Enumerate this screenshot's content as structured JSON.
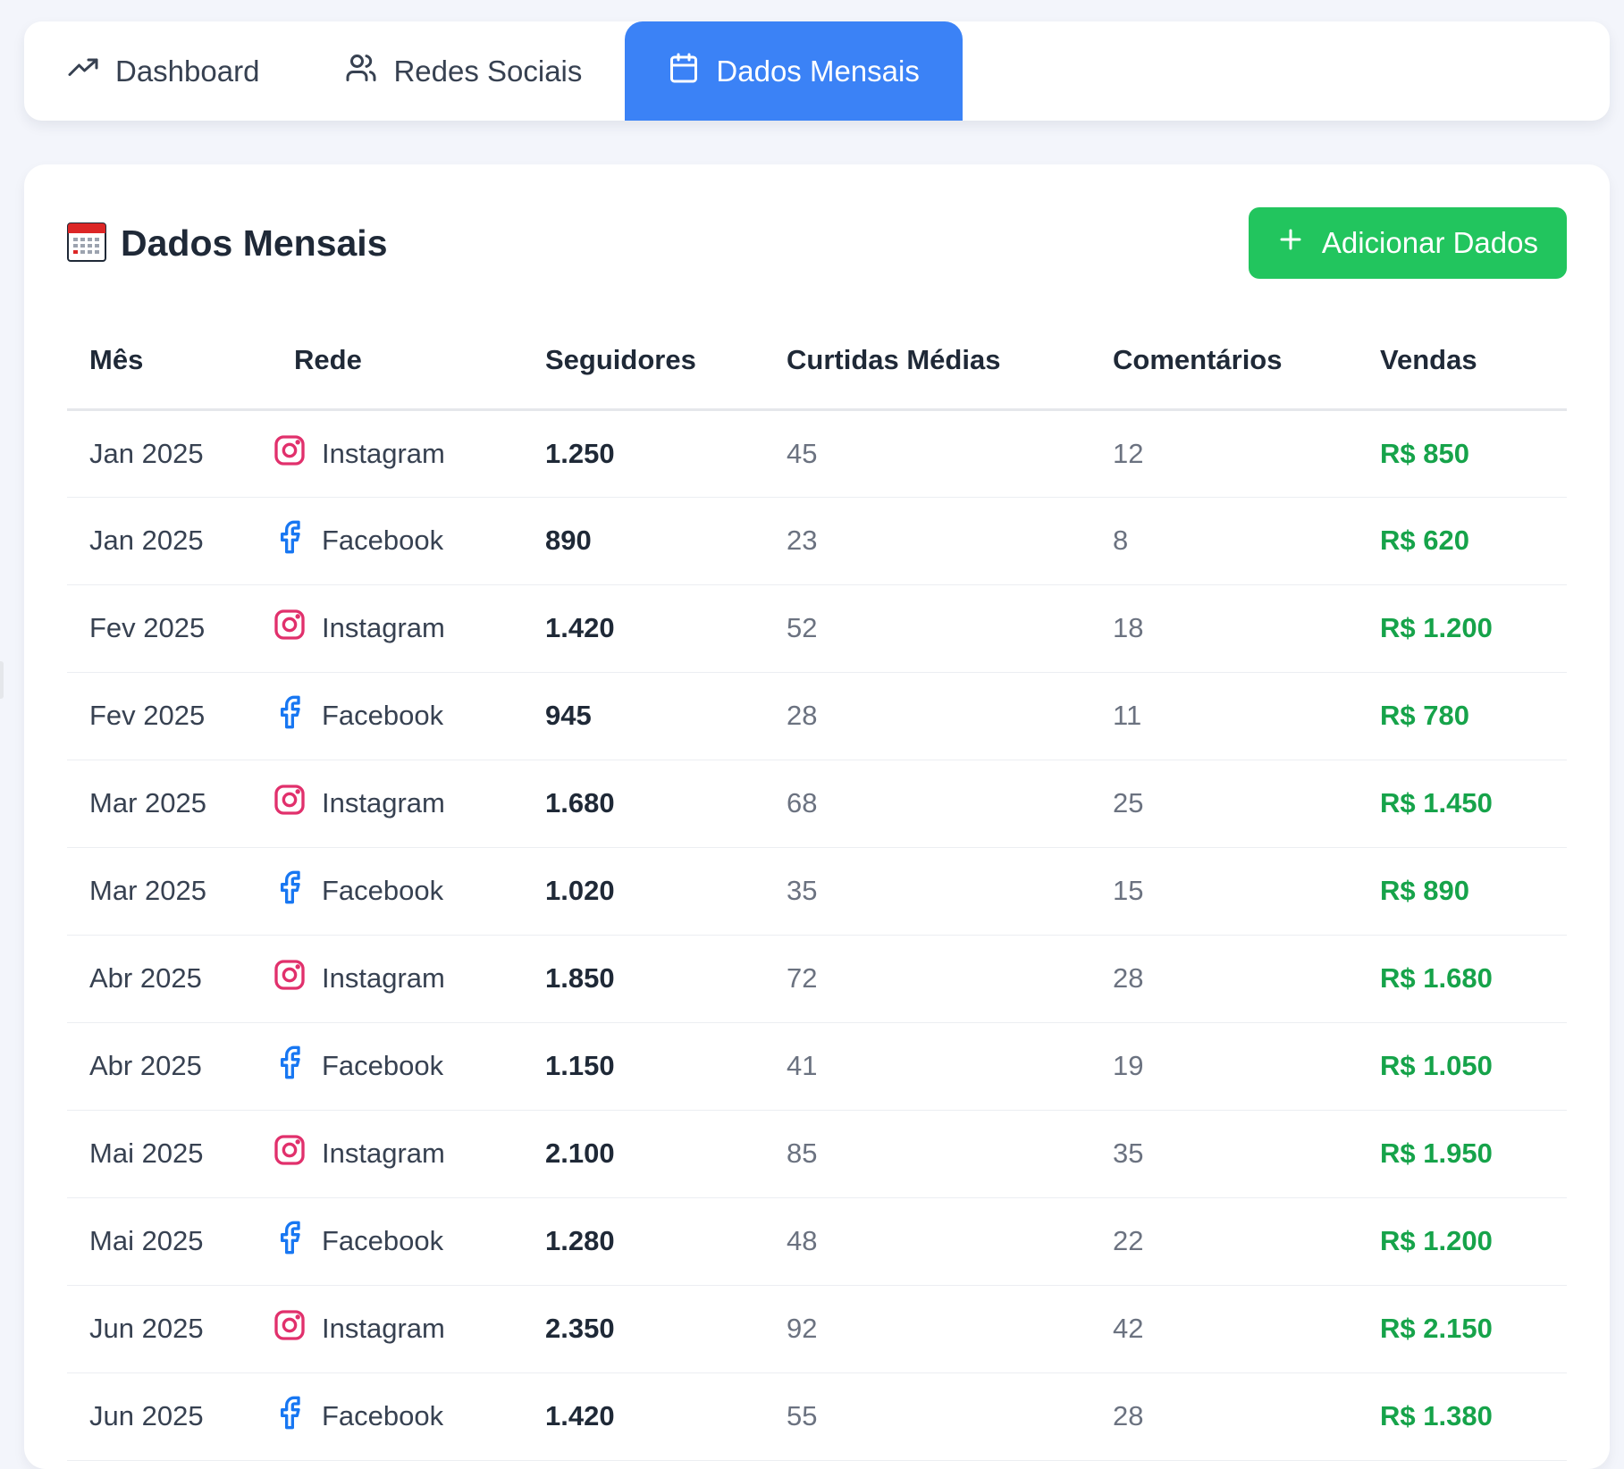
{
  "tabs": [
    {
      "label": "Dashboard",
      "icon": "trending-up-icon"
    },
    {
      "label": "Redes Sociais",
      "icon": "users-icon"
    },
    {
      "label": "Dados Mensais",
      "icon": "calendar-icon",
      "active": true
    }
  ],
  "section": {
    "title": "Dados Mensais",
    "title_icon": "calendar-emoji-icon",
    "add_button_label": "Adicionar Dados"
  },
  "colors": {
    "accent": "#3b82f6",
    "success": "#22c55e",
    "sales_text": "#16a34a",
    "instagram": "#e1306c",
    "facebook": "#1877f2"
  },
  "table": {
    "headers": [
      "Mês",
      "Rede",
      "Seguidores",
      "Curtidas Médias",
      "Comentários",
      "Vendas"
    ],
    "rows": [
      {
        "month": "Jan 2025",
        "network": "Instagram",
        "followers": "1.250",
        "likes": "45",
        "comments": "12",
        "sales": "R$ 850"
      },
      {
        "month": "Jan 2025",
        "network": "Facebook",
        "followers": "890",
        "likes": "23",
        "comments": "8",
        "sales": "R$ 620"
      },
      {
        "month": "Fev 2025",
        "network": "Instagram",
        "followers": "1.420",
        "likes": "52",
        "comments": "18",
        "sales": "R$ 1.200"
      },
      {
        "month": "Fev 2025",
        "network": "Facebook",
        "followers": "945",
        "likes": "28",
        "comments": "11",
        "sales": "R$ 780"
      },
      {
        "month": "Mar 2025",
        "network": "Instagram",
        "followers": "1.680",
        "likes": "68",
        "comments": "25",
        "sales": "R$ 1.450"
      },
      {
        "month": "Mar 2025",
        "network": "Facebook",
        "followers": "1.020",
        "likes": "35",
        "comments": "15",
        "sales": "R$ 890"
      },
      {
        "month": "Abr 2025",
        "network": "Instagram",
        "followers": "1.850",
        "likes": "72",
        "comments": "28",
        "sales": "R$ 1.680"
      },
      {
        "month": "Abr 2025",
        "network": "Facebook",
        "followers": "1.150",
        "likes": "41",
        "comments": "19",
        "sales": "R$ 1.050"
      },
      {
        "month": "Mai 2025",
        "network": "Instagram",
        "followers": "2.100",
        "likes": "85",
        "comments": "35",
        "sales": "R$ 1.950"
      },
      {
        "month": "Mai 2025",
        "network": "Facebook",
        "followers": "1.280",
        "likes": "48",
        "comments": "22",
        "sales": "R$ 1.200"
      },
      {
        "month": "Jun 2025",
        "network": "Instagram",
        "followers": "2.350",
        "likes": "92",
        "comments": "42",
        "sales": "R$ 2.150"
      },
      {
        "month": "Jun 2025",
        "network": "Facebook",
        "followers": "1.420",
        "likes": "55",
        "comments": "28",
        "sales": "R$ 1.380"
      }
    ]
  }
}
